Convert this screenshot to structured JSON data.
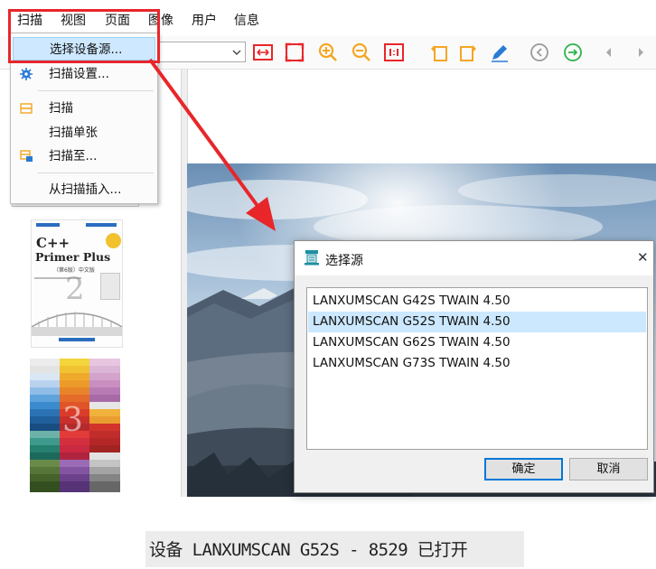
{
  "menubar": {
    "items": [
      "扫描",
      "视图",
      "页面",
      "图像",
      "用户",
      "信息"
    ]
  },
  "dropdown": {
    "items": [
      {
        "label": "选择设备源...",
        "icon": "none",
        "selected": true
      },
      {
        "label": "扫描设置...",
        "icon": "gear-icon"
      },
      {
        "label": "扫描",
        "icon": "scan-icon"
      },
      {
        "label": "扫描单张",
        "icon": "none"
      },
      {
        "label": "扫描至...",
        "icon": "scan-to-icon"
      },
      {
        "label": "从扫描插入...",
        "icon": "none"
      }
    ]
  },
  "toolbar": {
    "combo_value": "",
    "icons": [
      "fit-width-icon",
      "fit-page-icon",
      "zoom-in-icon",
      "zoom-out-icon",
      "actual-size-icon",
      "rotate-left-icon",
      "rotate-right-icon",
      "edit-pen-icon",
      "previous-circle-icon",
      "next-circle-icon",
      "prev-arrow-icon",
      "next-arrow-icon"
    ]
  },
  "thumbnails": {
    "book": {
      "title_line1": "C++",
      "title_line2": "Primer Plus",
      "edition": "（第6版）中文版",
      "page_number": "2"
    },
    "colors": {
      "page_number": "3"
    }
  },
  "dialog": {
    "title": "选择源",
    "items": [
      "LANXUMSCAN G42S TWAIN 4.50",
      "LANXUMSCAN G52S TWAIN 4.50",
      "LANXUMSCAN G62S TWAIN 4.50",
      "LANXUMSCAN G73S TWAIN 4.50"
    ],
    "selected_index": 1,
    "ok_label": "确定",
    "cancel_label": "取消",
    "close_glyph": "✕"
  },
  "status": {
    "text": "设备 LANXUMSCAN G52S - 8529 已打开"
  },
  "colors": {
    "accent_red": "#e8262a",
    "highlight_blue": "#cde8ff",
    "toolbar_orange": "#f5a623",
    "toolbar_green": "#2db34a",
    "button_border_blue": "#0078d7"
  }
}
